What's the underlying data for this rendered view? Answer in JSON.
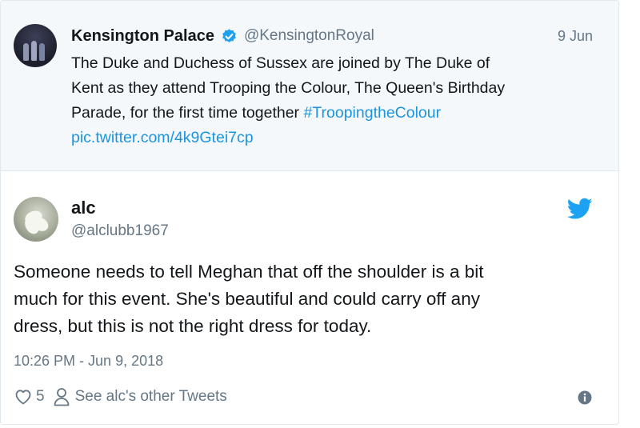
{
  "quoted_tweet": {
    "display_name": "Kensington Palace",
    "handle": "@KensingtonRoyal",
    "date": "9 Jun",
    "text_line1": "The Duke and Duchess of Sussex are joined by The Duke of",
    "text_line2": "Kent as they attend Trooping the Colour, The Queen's Birthday",
    "text_line3": "Parade, for the first time together ",
    "hashtag": "#TroopingtheColour",
    "pic_link": "pic.twitter.com/4k9Gtei7cp",
    "verified": true
  },
  "tweet": {
    "display_name": "alc",
    "handle": "@alclubb1967",
    "text_line1": "Someone needs to tell Meghan that off the shoulder is a bit",
    "text_line2": "much for this event. She's beautiful and could carry off any",
    "text_line3": "dress, but this is not the right dress for today.",
    "timestamp": "10:26 PM - Jun 9, 2018",
    "like_count": "5",
    "other_tweets_label": "See alc's other Tweets"
  },
  "icons": {
    "verified": "verified-badge-icon",
    "twitter": "twitter-bird-icon",
    "like": "heart-icon",
    "profile": "person-icon",
    "info": "info-icon"
  },
  "colors": {
    "link": "#1b95e0",
    "secondary_text": "#657786",
    "quoted_background": "#f5f8fa",
    "twitter_blue": "#1da1f2"
  }
}
